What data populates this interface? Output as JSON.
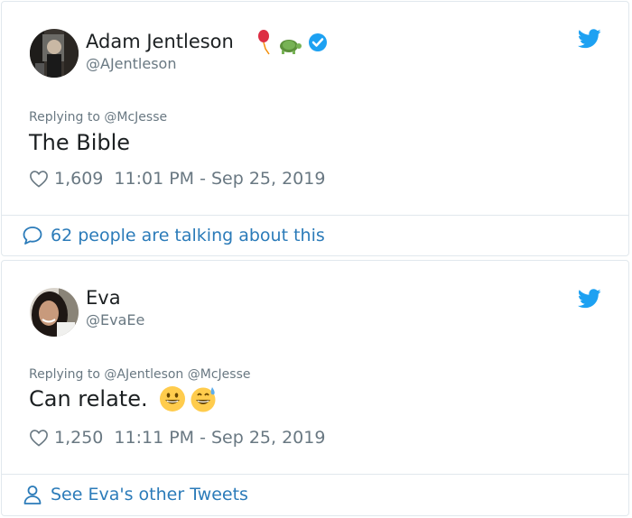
{
  "tweets": [
    {
      "name": "Adam Jentleson",
      "handle": "@AJentleson",
      "name_icons": [
        "balloon-emoji-icon",
        "turtle-emoji-icon",
        "verified-badge-icon"
      ],
      "reply_prefix": "Replying to ",
      "reply_to": "@McJesse",
      "text": "The Bible",
      "likes": "1,609",
      "timestamp": "11:01 PM - Sep 25, 2019",
      "footer": "62 people are talking about this",
      "footer_icon": "speech-bubble-icon"
    },
    {
      "name": "Eva",
      "handle": "@EvaEe",
      "reply_prefix": "Replying to ",
      "reply_to": "@AJentleson @McJesse",
      "text": "Can relate.",
      "text_emojis": [
        "grinning-face-emoji-icon",
        "grinning-sweat-emoji-icon"
      ],
      "likes": "1,250",
      "timestamp": "11:11 PM - Sep 25, 2019",
      "footer": "See Eva's other Tweets",
      "footer_icon": "person-icon"
    }
  ],
  "colors": {
    "link": "#2b7bb9",
    "muted": "#697882",
    "text": "#1c2022",
    "border": "#e1e8ed",
    "twitter_blue": "#1da1f2"
  }
}
